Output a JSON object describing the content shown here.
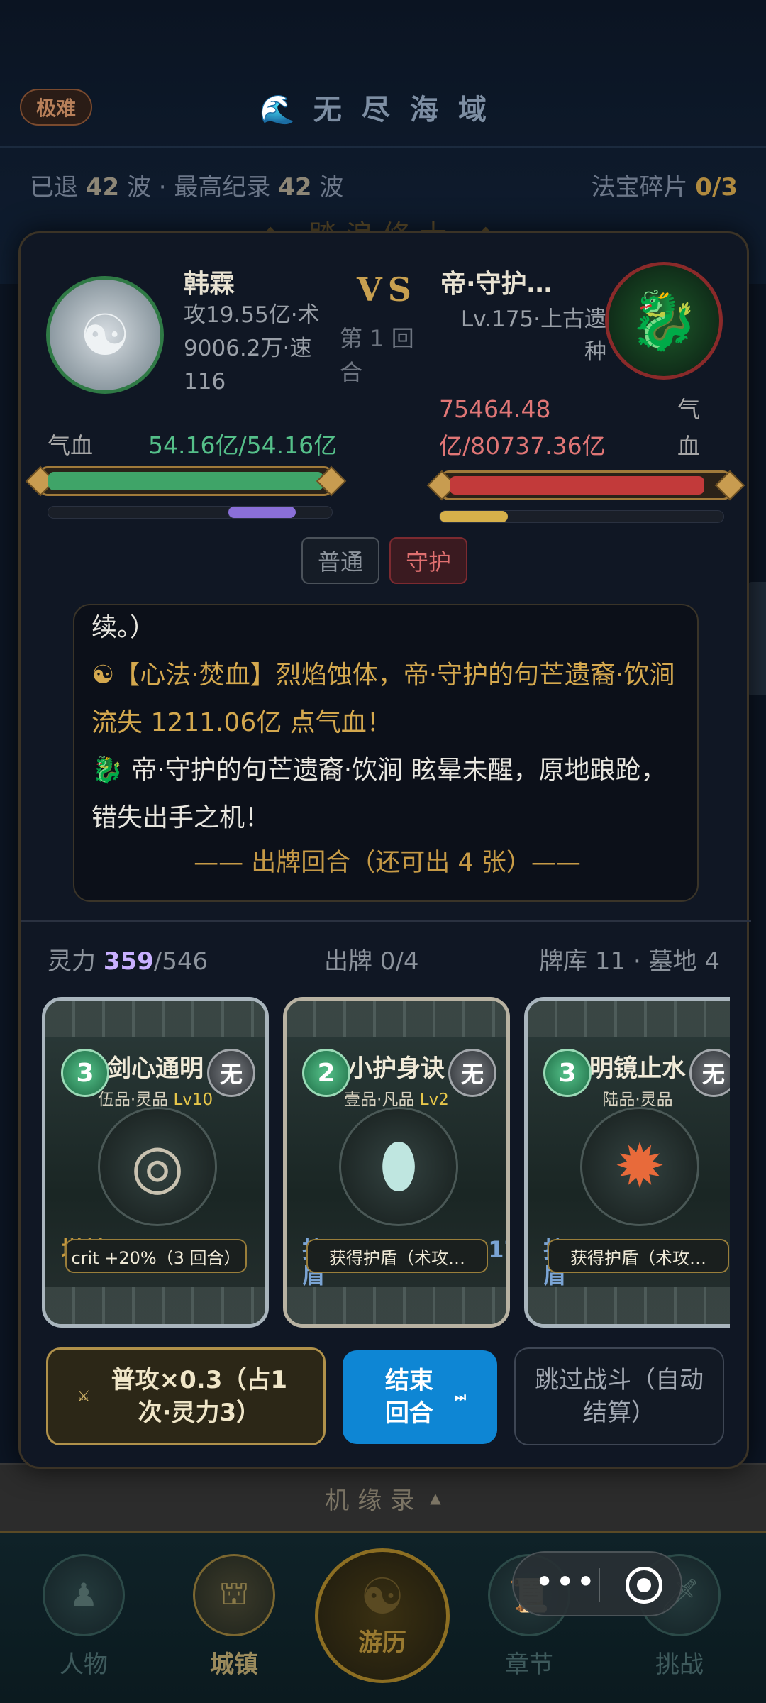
{
  "header": {
    "difficulty": "极难",
    "title_icon": "🌊",
    "title": "无尽海域",
    "stats_prefix": "已退 ",
    "stats_waves": "42",
    "stats_mid": " 波 · 最高纪录 ",
    "stats_record": "42",
    "stats_suffix": " 波",
    "shards_label": "法宝碎片 ",
    "shards_value": "0/3",
    "faint_title": "◆ 踏浪修士 ◆"
  },
  "battle": {
    "hero": {
      "avatar_icon": "swordsman-icon",
      "name": "韩霖",
      "stats": "攻19.55亿·术9006.2万·速116",
      "hp_label": "气血",
      "hp_text": "54.16亿/54.16亿",
      "hp_fraction": 1.0,
      "sub_bar_1_fraction": 0.0,
      "sub_bar_2_fraction": 0.65,
      "hp_color": "#3fa468",
      "sub_bar_2_color": "#8a6fd8"
    },
    "vs": "VS",
    "round_text": "第 1 回合",
    "boss": {
      "avatar_icon": "qilin-icon",
      "name": "帝·守护…",
      "stats": "Lv.175·上古遗种",
      "hp_label": "气血",
      "hp_text": "75464.48亿/80737.36亿",
      "hp_fraction": 0.935,
      "sub_bar_fraction": 0.24,
      "hp_color": "#c23a3a",
      "sub_bar_color": "#d6b04a"
    },
    "modes": [
      "普通",
      "守护"
    ]
  },
  "log": {
    "line_0": "续。）",
    "line_1_icon": "☯",
    "line_1": "【心法·焚血】烈焰蚀体，帝·守护的句芒遗裔·饮涧 流失 1211.06亿 点气血！",
    "line_2_icon": "🐉",
    "line_2": " 帝·守护的句芒遗裔·饮涧 眩晕未醒，原地踉跄，错失出手之机！",
    "footer": "—— 出牌回合（还可出 4 张）——"
  },
  "resources": {
    "spirit_label": "灵力 ",
    "spirit_value": "359",
    "spirit_max": "/546",
    "played": "出牌 0/4",
    "deck": "牌库 11 · 墓地 4"
  },
  "cards": [
    {
      "name": "剑心通明",
      "cost": "3",
      "element": "无",
      "grade": "伍品·灵品 ",
      "level": "Lv10",
      "art_icon": "jade-disc-icon",
      "effect": "增益 +20%",
      "tag": "crit +20%（3 回合）"
    },
    {
      "name": "小护身诀",
      "cost": "2",
      "element": "无",
      "grade": "壹品·凡品 ",
      "level": "Lv2",
      "art_icon": "jade-shield-icon",
      "effect": "护 ~1,211,241,176",
      "effect2": "盾",
      "tag": "获得护盾（术攻…"
    },
    {
      "name": "明镜止水",
      "cost": "3",
      "element": "无",
      "grade": "陆品·灵品",
      "level": "",
      "art_icon": "fire-phoenix-icon",
      "effect": "护 ~2,385,323,72",
      "effect2": "盾",
      "tag": "获得护盾（术攻…"
    }
  ],
  "actions": {
    "attack_icon": "⚔",
    "attack": "普攻×0.3（占1次·灵力3）",
    "end_turn": "结束回合",
    "end_icon": "⏭",
    "skip": "跳过战斗（自动结算）"
  },
  "jiyuan": {
    "label": "机缘录",
    "arrow": "▲"
  },
  "nav": {
    "items": [
      "人物",
      "城镇",
      "游历",
      "章节",
      "挑战"
    ],
    "center_icon": "☯"
  },
  "miniprogram": {
    "more": "•••"
  }
}
